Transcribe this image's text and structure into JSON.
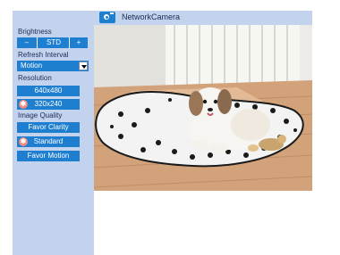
{
  "header": {
    "camera_icon": "camera-icon",
    "title": "NetworkCamera"
  },
  "sidebar": {
    "brightness": {
      "label": "Brightness",
      "decrease": "–",
      "standard": "STD",
      "increase": "+"
    },
    "refresh": {
      "label": "Refresh Interval",
      "selected": "Motion"
    },
    "resolution": {
      "label": "Resolution",
      "options": [
        "640x480",
        "320x240"
      ],
      "selected_index": 1
    },
    "image_quality": {
      "label": "Image Quality",
      "options": [
        "Favor Clarity",
        "Standard",
        "Favor Motion"
      ],
      "selected_index": 1
    }
  },
  "stream": {
    "description_icon": "camera-feed-image"
  },
  "colors": {
    "panel": "#c3d3ee",
    "button": "#1e7ed0",
    "selected_marker": "#f08a80",
    "text": "#1b2a55"
  }
}
